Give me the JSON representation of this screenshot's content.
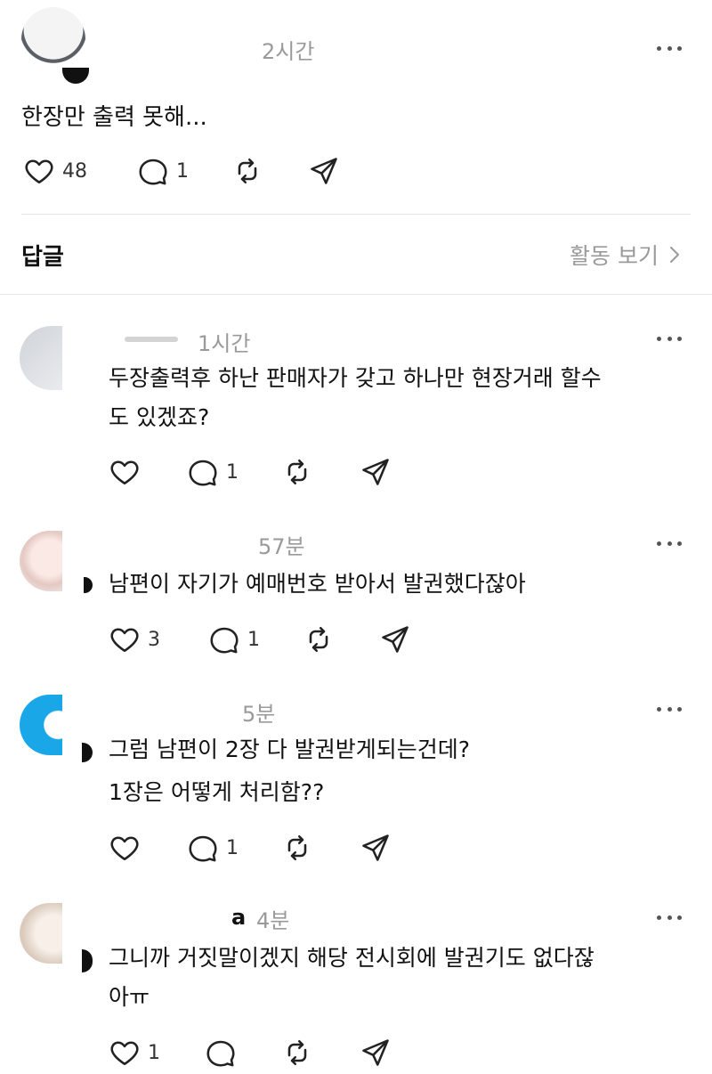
{
  "post": {
    "time": "2시간",
    "text": "한장만 출력 못해...",
    "likes": "48",
    "replies": "1"
  },
  "replies_header": {
    "title": "답글",
    "activity_link": "활동 보기"
  },
  "comments": [
    {
      "username_fragment": "",
      "time": "1시간",
      "text_line1": "두장출력후 하난 판매자가 갖고 하나만 현장거래 할수",
      "text_line2": "도 있겠죠?",
      "likes": "",
      "replies": "1"
    },
    {
      "username_fragment": "",
      "time": "57분",
      "text_line1": "남편이 자기가 예매번호 받아서 발권했다잖아",
      "text_line2": "",
      "likes": "3",
      "replies": "1"
    },
    {
      "username_fragment": "",
      "time": "5분",
      "text_line1": "그럼 남편이 2장 다 발권받게되는건데?",
      "text_line2": "1장은 어떻게 처리함??",
      "likes": "",
      "replies": "1"
    },
    {
      "username_fragment": "a",
      "time": "4분",
      "text_line1": "그니까 거짓말이겠지 해당 전시회에 발권기도 없다잖",
      "text_line2": "아ㅠ",
      "likes": "1",
      "replies": ""
    }
  ],
  "icons": {
    "like": "heart-icon",
    "reply": "comment-bubble-icon",
    "repost": "repost-icon",
    "share": "send-icon",
    "more": "more-dots-icon",
    "chevron": "chevron-right-icon"
  }
}
